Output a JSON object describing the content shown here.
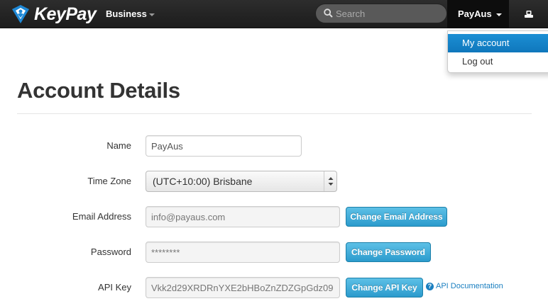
{
  "navbar": {
    "brand": "KeyPay",
    "business_menu": "Business",
    "search": {
      "placeholder": "Search",
      "value": ""
    },
    "user_menu": "PayAus"
  },
  "dropdown": {
    "items": [
      {
        "label": "My account",
        "active": true
      },
      {
        "label": "Log out",
        "active": false
      }
    ]
  },
  "page": {
    "title": "Account Details"
  },
  "form": {
    "name": {
      "label": "Name",
      "value": "PayAus"
    },
    "timezone": {
      "label": "Time Zone",
      "value": "(UTC+10:00) Brisbane"
    },
    "email": {
      "label": "Email Address",
      "value": "info@payaus.com",
      "button": "Change Email Address"
    },
    "password": {
      "label": "Password",
      "value": "********",
      "button": "Change Password"
    },
    "api_key": {
      "label": "API Key",
      "value": "Vkk2d29XRDRnYXE2bHBoZnZDZGpGdz09",
      "button": "Change API Key",
      "help_link": "API Documentation"
    }
  },
  "colors": {
    "accent": "#2b9bcd",
    "navbar": "#1c1c1c",
    "dropdown_active": "#0f77bc",
    "link": "#1a7fc0"
  },
  "icons": [
    "keypay-logo-icon",
    "search-icon",
    "user-profile-icon",
    "help-icon"
  ]
}
